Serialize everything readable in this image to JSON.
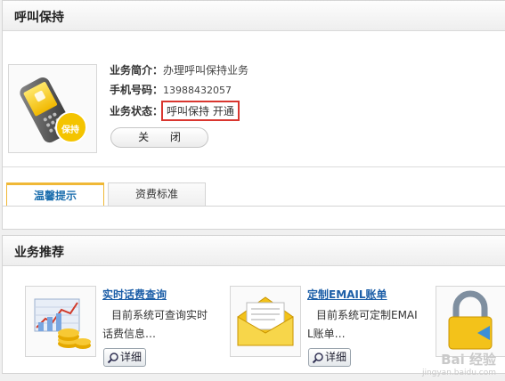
{
  "service_panel": {
    "title": "呼叫保持",
    "intro_label": "业务简介：",
    "intro_value": "办理呼叫保持业务",
    "phone_label": "手机号码：",
    "phone_value": "13988432057",
    "status_label": "业务状态：",
    "status_value": "呼叫保持 开通",
    "close_button": "关 闭",
    "image_badge": "保持",
    "tabs": [
      {
        "label": "温馨提示",
        "active": true
      },
      {
        "label": "资费标准",
        "active": false
      }
    ]
  },
  "recommend_panel": {
    "title": "业务推荐",
    "items": [
      {
        "title": "实时话费查询",
        "desc_line1": "目前系统可查询实时",
        "desc_line2": "话费信息…",
        "button": "详细",
        "icon": "chart-coins-icon"
      },
      {
        "title": "定制EMAIL账单",
        "desc_line1": "目前系统可定制EMAI",
        "desc_line2": "L账单…",
        "button": "详细",
        "icon": "envelope-icon"
      },
      {
        "icon": "lock-icon"
      }
    ]
  },
  "watermark": {
    "text": "Bai 经验",
    "sub": "jingyan.baidu.com"
  },
  "colors": {
    "accent_tab": "#f0b836",
    "link": "#1d5fa8",
    "status_border": "#d9362f"
  }
}
